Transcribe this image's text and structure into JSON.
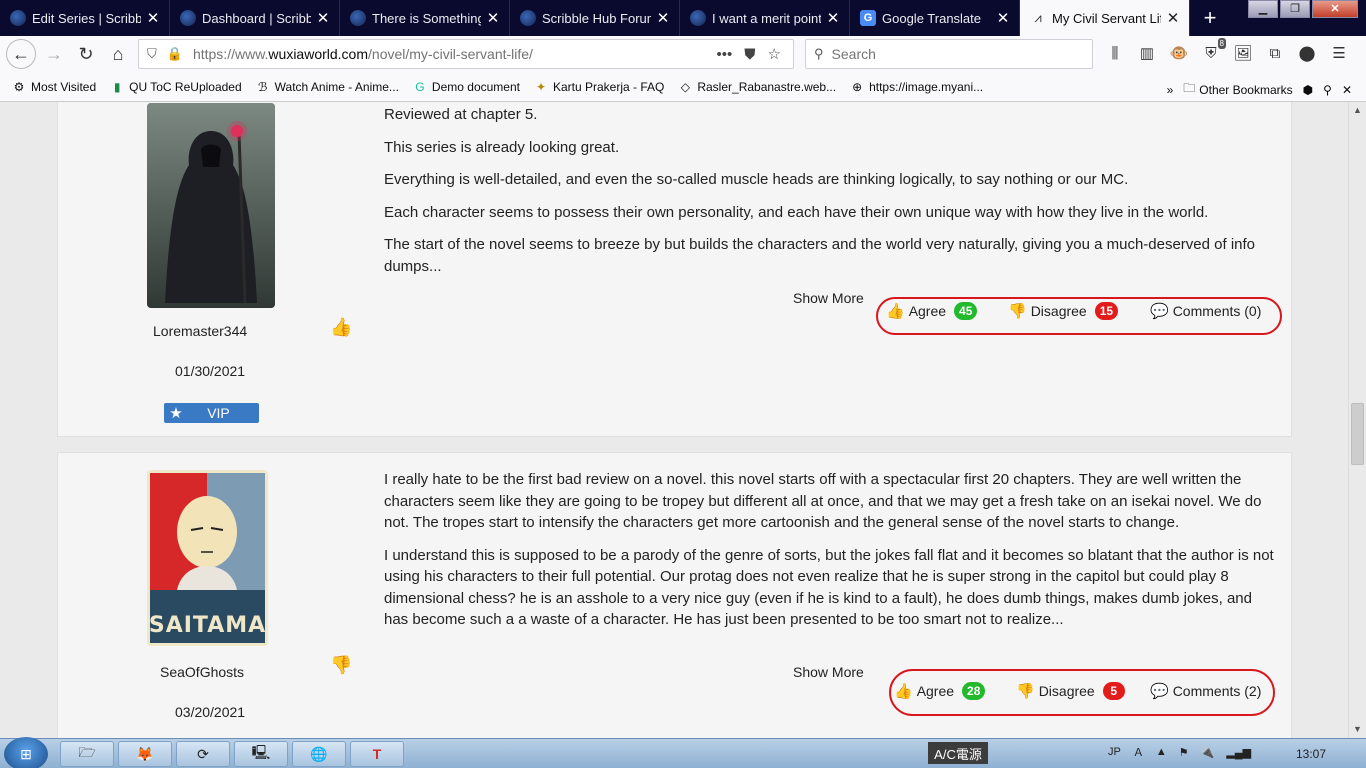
{
  "browser": {
    "tabs": [
      {
        "title": "Edit Series | Scribble Hub",
        "icon": "scribble-hub-icon"
      },
      {
        "title": "Dashboard | Scribble Hub",
        "icon": "scribble-hub-icon"
      },
      {
        "title": "There is Something Wrong",
        "icon": "scribble-hub-icon"
      },
      {
        "title": "Scribble Hub Forum",
        "icon": "scribble-hub-icon"
      },
      {
        "title": "I want a merit point system",
        "icon": "scribble-hub-icon"
      },
      {
        "title": "Google Translate",
        "icon": "google-translate-icon"
      },
      {
        "title": "My Civil Servant Life",
        "icon": "wuxiaworld-icon"
      }
    ],
    "url_prefix": "https://www.",
    "url_domain": "wuxiaworld.com",
    "url_path": "/novel/my-civil-servant-life/",
    "search_placeholder": "Search",
    "addon_badge": "8"
  },
  "bookmarks": [
    {
      "label": "Most Visited",
      "icon": "gear-icon"
    },
    {
      "label": "QU ToC ReUploaded",
      "icon": "bookmark-icon"
    },
    {
      "label": "Watch Anime - Anime...",
      "icon": "anime-icon"
    },
    {
      "label": "Demo document",
      "icon": "grammarly-icon"
    },
    {
      "label": "Kartu Prakerja - FAQ",
      "icon": "garuda-icon"
    },
    {
      "label": "Rasler_Rabanastre.web...",
      "icon": "diamond-icon"
    },
    {
      "label": "https://image.myani...",
      "icon": "globe-icon"
    }
  ],
  "bookmarks_other": "Other Bookmarks",
  "reviews": [
    {
      "username": "Loremaster344",
      "date": "01/30/2021",
      "badge": "VIP",
      "recommend": "thumbs-up",
      "paragraphs": [
        "Reviewed at chapter 5.",
        "This series is already looking great.",
        "Everything is well-detailed, and even the so-called muscle heads are thinking logically, to say nothing or our MC.",
        "Each character seems to possess their own personality, and each have their own unique way with how they live in the world.",
        "The start of the novel seems to breeze by but builds the characters and the world very naturally, giving you a much-deserved of info dumps..."
      ],
      "show_more": "Show More",
      "agree_label": "Agree",
      "agree_count": "45",
      "disagree_label": "Disagree",
      "disagree_count": "15",
      "comments_label": "Comments (0)"
    },
    {
      "username": "SeaOfGhosts",
      "date": "03/20/2021",
      "recommend": "thumbs-down",
      "avatar_caption": "SAITAMA",
      "paragraphs": [
        "I really hate to be the first bad review on a novel. this novel starts off with a spectacular first 20 chapters. They are well written the characters seem like they are going to be tropey but different all at once, and that we may get a fresh take on an isekai novel. We do not. The tropes start to intensify the characters get more cartoonish and the general sense of the novel starts to change.",
        "I understand this is supposed to be a parody of the genre of sorts, but the jokes fall flat and it becomes so blatant that the author is not using his characters to their full potential. Our protag does not even realize that he is super strong in the capitol but could play 8 dimensional chess? he is an asshole to a very nice guy (even if he is kind to a fault), he does dumb things, makes dumb jokes, and has become such a a waste of a character. He has just been presented to be too smart not to realize..."
      ],
      "show_more": "Show More",
      "agree_label": "Agree",
      "agree_count": "28",
      "disagree_label": "Disagree",
      "disagree_count": "5",
      "comments_label": "Comments (2)"
    }
  ],
  "taskbar": {
    "ime_label": "A/C電源",
    "lang": "JP",
    "time": "13:07"
  },
  "colors": {
    "agree": "#22b92d",
    "disagree": "#e21b1b",
    "vip": "#3a7ac4",
    "highlight_ring": "#d8161c"
  }
}
